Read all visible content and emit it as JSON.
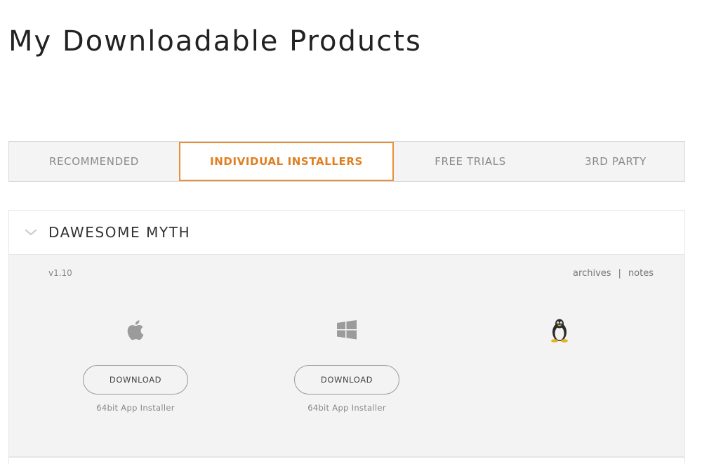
{
  "page": {
    "title": "My Downloadable Products"
  },
  "tabs": [
    {
      "label": "RECOMMENDED",
      "active": false
    },
    {
      "label": "INDIVIDUAL INSTALLERS",
      "active": true
    },
    {
      "label": "FREE TRIALS",
      "active": false
    },
    {
      "label": "3RD PARTY",
      "active": false
    }
  ],
  "colors": {
    "accent": "#e8913a",
    "panel_bg": "#f3f3f3"
  },
  "product": {
    "name": "DAWESOME MYTH",
    "version": "v1.10",
    "links": {
      "archives": "archives",
      "separator": "|",
      "notes": "notes"
    },
    "platforms": {
      "mac": {
        "icon": "apple-icon",
        "button_label": "DOWNLOAD",
        "caption": "64bit App Installer"
      },
      "windows": {
        "icon": "windows-icon",
        "button_label": "DOWNLOAD",
        "caption": "64bit App Installer"
      },
      "linux": {
        "icon": "linux-tux-icon"
      }
    }
  }
}
